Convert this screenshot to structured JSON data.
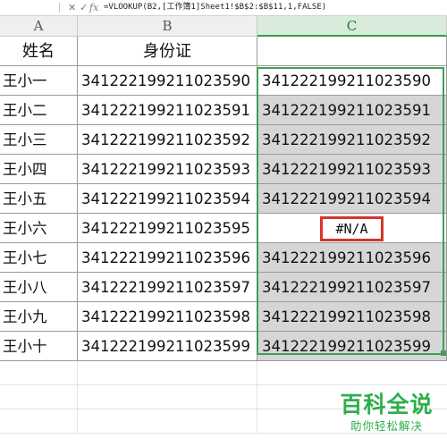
{
  "formula_bar": {
    "cancel_icon": "✕",
    "confirm_icon": "✓",
    "fx_label": "fx",
    "formula": "=VLOOKUP(B2,[工作簿1]Sheet1!$B$2:$B$11,1,FALSE)"
  },
  "columns": [
    "A",
    "B",
    "C"
  ],
  "header_row": {
    "a": "姓名",
    "b": "身份证",
    "c": ""
  },
  "rows": [
    {
      "a": "王小一",
      "b": "341222199211023590",
      "c": "341222199211023590"
    },
    {
      "a": "王小二",
      "b": "341222199211023591",
      "c": "341222199211023591"
    },
    {
      "a": "王小三",
      "b": "341222199211023592",
      "c": "341222199211023592"
    },
    {
      "a": "王小四",
      "b": "341222199211023593",
      "c": "341222199211023593"
    },
    {
      "a": "王小五",
      "b": "341222199211023594",
      "c": "341222199211023594"
    },
    {
      "a": "王小六",
      "b": "341222199211023595",
      "c": "#N/A"
    },
    {
      "a": "王小七",
      "b": "341222199211023596",
      "c": "341222199211023596"
    },
    {
      "a": "王小八",
      "b": "341222199211023597",
      "c": "341222199211023597"
    },
    {
      "a": "王小九",
      "b": "341222199211023598",
      "c": "341222199211023598"
    },
    {
      "a": "王小十",
      "b": "341222199211023599",
      "c": "341222199211023599"
    }
  ],
  "watermark": {
    "title": "百科全说",
    "subtitle": "助你轻松解决"
  },
  "colors": {
    "selection": "#3f9f55",
    "error_box": "#d9342b",
    "watermark": "#2fae4b"
  }
}
